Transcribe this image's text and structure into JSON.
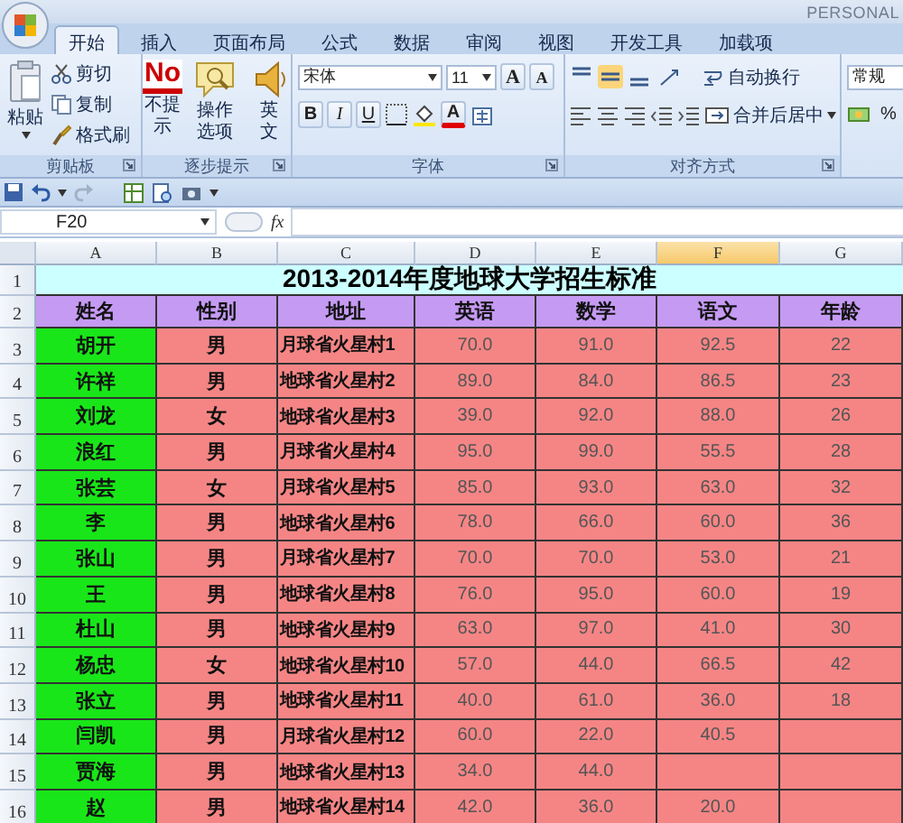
{
  "title_bar": {
    "edition": "PERSONAL"
  },
  "tabs": [
    {
      "label": "开始",
      "selected": true
    },
    {
      "label": "插入",
      "selected": false
    },
    {
      "label": "页面布局",
      "selected": false
    },
    {
      "label": "公式",
      "selected": false
    },
    {
      "label": "数据",
      "selected": false
    },
    {
      "label": "审阅",
      "selected": false
    },
    {
      "label": "视图",
      "selected": false
    },
    {
      "label": "开发工具",
      "selected": false
    },
    {
      "label": "加载项",
      "selected": false
    }
  ],
  "ribbon": {
    "clipboard": {
      "label": "剪贴板",
      "paste": "粘贴",
      "cut": "剪切",
      "copy": "复制",
      "format_painter": "格式刷"
    },
    "hints": {
      "label": "逐步提示",
      "buttons": [
        {
          "label": "不提示",
          "badge": "No"
        },
        {
          "label": "操作选项"
        },
        {
          "label": "英文"
        }
      ]
    },
    "font": {
      "label": "字体",
      "name": "宋体",
      "size": "11",
      "grow": "A",
      "shrink": "A",
      "bold": "B",
      "italic": "I",
      "underline": "U",
      "color_letter": "A"
    },
    "alignment": {
      "label": "对齐方式",
      "vertical": [
        {
          "selected": false
        },
        {
          "selected": true
        },
        {
          "selected": false
        }
      ],
      "wrap": "自动换行",
      "merge": "合并后居中"
    },
    "number": {
      "format": "常规",
      "percent": "%"
    }
  },
  "formula_bar": {
    "name_box": "F20",
    "fx": "fx"
  },
  "sheet": {
    "columns": [
      {
        "letter": "A",
        "selected": false
      },
      {
        "letter": "B",
        "selected": false
      },
      {
        "letter": "C",
        "selected": false
      },
      {
        "letter": "D",
        "selected": false
      },
      {
        "letter": "E",
        "selected": false
      },
      {
        "letter": "F",
        "selected": true
      },
      {
        "letter": "G",
        "selected": false
      }
    ],
    "title_row": "1",
    "title": "2013-2014年度地球大学招生标准",
    "header_row": "2",
    "headers": [
      "姓名",
      "性别",
      "地址",
      "英语",
      "数学",
      "语文",
      "年龄"
    ],
    "rows": [
      {
        "number": "3",
        "cells": [
          "胡开",
          "男",
          "月球省火星村1",
          "70.0",
          "91.0",
          "92.5",
          "22"
        ]
      },
      {
        "number": "4",
        "cells": [
          "许祥",
          "男",
          "地球省火星村2",
          "89.0",
          "84.0",
          "86.5",
          "23"
        ]
      },
      {
        "number": "5",
        "cells": [
          "刘龙",
          "女",
          "地球省火星村3",
          "39.0",
          "92.0",
          "88.0",
          "26"
        ]
      },
      {
        "number": "6",
        "cells": [
          "浪红",
          "男",
          "月球省火星村4",
          "95.0",
          "99.0",
          "55.5",
          "28"
        ]
      },
      {
        "number": "7",
        "cells": [
          "张芸",
          "女",
          "月球省火星村5",
          "85.0",
          "93.0",
          "63.0",
          "32"
        ]
      },
      {
        "number": "8",
        "cells": [
          "李",
          "男",
          "地球省火星村6",
          "78.0",
          "66.0",
          "60.0",
          "36"
        ]
      },
      {
        "number": "9",
        "cells": [
          "张山",
          "男",
          "月球省火星村7",
          "70.0",
          "70.0",
          "53.0",
          "21"
        ]
      },
      {
        "number": "10",
        "cells": [
          "王",
          "男",
          "地球省火星村8",
          "76.0",
          "95.0",
          "60.0",
          "19"
        ]
      },
      {
        "number": "11",
        "cells": [
          "杜山",
          "男",
          "地球省火星村9",
          "63.0",
          "97.0",
          "41.0",
          "30"
        ]
      },
      {
        "number": "12",
        "cells": [
          "杨忠",
          "女",
          "地球省火星村10",
          "57.0",
          "44.0",
          "66.5",
          "42"
        ]
      },
      {
        "number": "13",
        "cells": [
          "张立",
          "男",
          "地球省火星村11",
          "40.0",
          "61.0",
          "36.0",
          "18"
        ]
      },
      {
        "number": "14",
        "cells": [
          "闫凯",
          "男",
          "月球省火星村12",
          "60.0",
          "22.0",
          "40.5"
        ]
      },
      {
        "number": "15",
        "cells": [
          "贾海",
          "男",
          "地球省火星村13",
          "34.0",
          "44.0"
        ]
      },
      {
        "number": "16",
        "cells": [
          "赵",
          "男",
          "地球省火星村14",
          "42.0",
          "36.0",
          "20.0"
        ]
      }
    ]
  }
}
